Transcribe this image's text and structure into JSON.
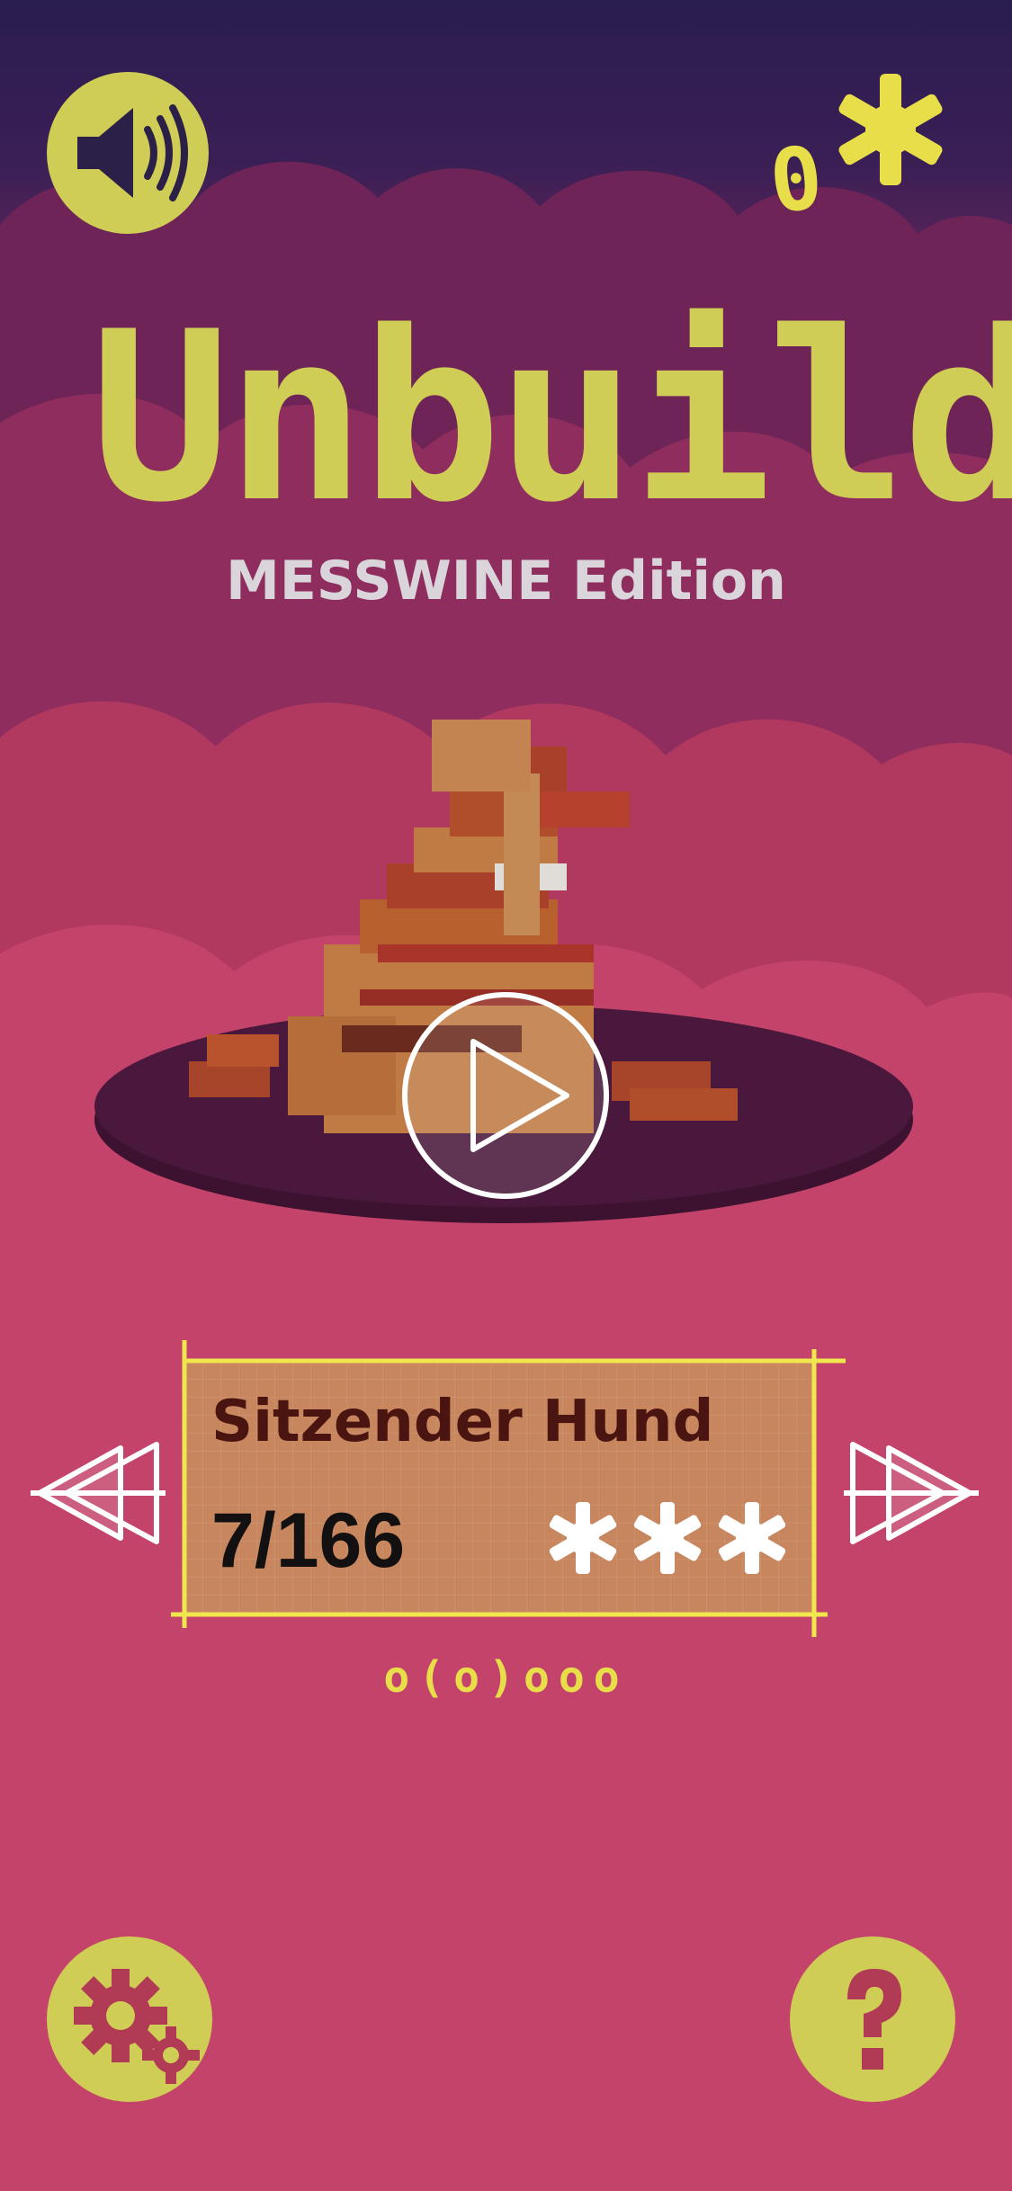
{
  "header": {
    "sound_icon": "speaker-volume-icon",
    "star_count": "0",
    "star_icon": "asterisk-star-icon"
  },
  "title": {
    "main": "Unbuild",
    "subtitle": "MESSWINE Edition"
  },
  "preview": {
    "play_icon": "play-icon"
  },
  "level": {
    "name": "Sitzender Hund",
    "progress": "7/166",
    "stars_earned": 3,
    "stars_total": 3,
    "prev_icon": "double-chevron-left-icon",
    "next_icon": "double-chevron-right-icon"
  },
  "pager": {
    "indicator": "o(o)ooo"
  },
  "footer": {
    "settings_icon": "gears-icon",
    "help_icon": "question-mark-icon"
  },
  "colors": {
    "accent_yellow": "#cfcd55",
    "star_yellow": "#e8de4a",
    "panel_brown": "#c8865e",
    "background_pink": "#c4436a",
    "sky_navy": "#2a1d50"
  }
}
